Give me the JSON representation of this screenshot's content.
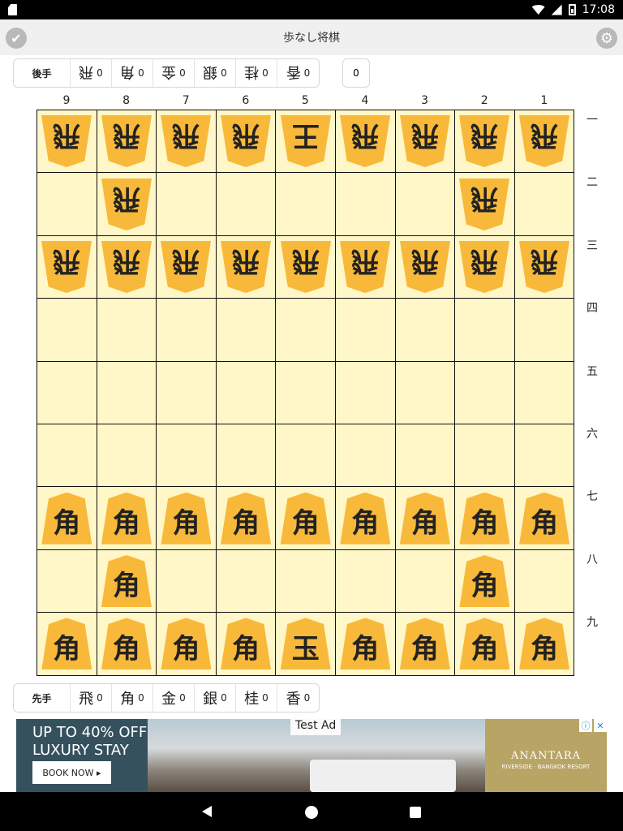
{
  "status_bar": {
    "time": "17:08"
  },
  "app": {
    "title": "歩なし将棋"
  },
  "gote_hand": {
    "label": "後手",
    "pieces": [
      {
        "kanji": "飛",
        "count": "0"
      },
      {
        "kanji": "角",
        "count": "0"
      },
      {
        "kanji": "金",
        "count": "0"
      },
      {
        "kanji": "銀",
        "count": "0"
      },
      {
        "kanji": "桂",
        "count": "0"
      },
      {
        "kanji": "香",
        "count": "0"
      }
    ],
    "extra_count": "0"
  },
  "sente_hand": {
    "label": "先手",
    "pieces": [
      {
        "kanji": "飛",
        "count": "0"
      },
      {
        "kanji": "角",
        "count": "0"
      },
      {
        "kanji": "金",
        "count": "0"
      },
      {
        "kanji": "銀",
        "count": "0"
      },
      {
        "kanji": "桂",
        "count": "0"
      },
      {
        "kanji": "香",
        "count": "0"
      }
    ]
  },
  "board": {
    "columns": [
      "9",
      "8",
      "7",
      "6",
      "5",
      "4",
      "3",
      "2",
      "1"
    ],
    "rows": [
      "一",
      "二",
      "三",
      "四",
      "五",
      "六",
      "七",
      "八",
      "九"
    ],
    "grid": [
      [
        {
          "k": "飛",
          "o": "gote"
        },
        {
          "k": "飛",
          "o": "gote"
        },
        {
          "k": "飛",
          "o": "gote"
        },
        {
          "k": "飛",
          "o": "gote"
        },
        {
          "k": "王",
          "o": "gote"
        },
        {
          "k": "飛",
          "o": "gote"
        },
        {
          "k": "飛",
          "o": "gote"
        },
        {
          "k": "飛",
          "o": "gote"
        },
        {
          "k": "飛",
          "o": "gote"
        }
      ],
      [
        null,
        {
          "k": "飛",
          "o": "gote"
        },
        null,
        null,
        null,
        null,
        null,
        {
          "k": "飛",
          "o": "gote"
        },
        null
      ],
      [
        {
          "k": "飛",
          "o": "gote"
        },
        {
          "k": "飛",
          "o": "gote"
        },
        {
          "k": "飛",
          "o": "gote"
        },
        {
          "k": "飛",
          "o": "gote"
        },
        {
          "k": "飛",
          "o": "gote"
        },
        {
          "k": "飛",
          "o": "gote"
        },
        {
          "k": "飛",
          "o": "gote"
        },
        {
          "k": "飛",
          "o": "gote"
        },
        {
          "k": "飛",
          "o": "gote"
        }
      ],
      [
        null,
        null,
        null,
        null,
        null,
        null,
        null,
        null,
        null
      ],
      [
        null,
        null,
        null,
        null,
        null,
        null,
        null,
        null,
        null
      ],
      [
        null,
        null,
        null,
        null,
        null,
        null,
        null,
        null,
        null
      ],
      [
        {
          "k": "角",
          "o": "sente"
        },
        {
          "k": "角",
          "o": "sente"
        },
        {
          "k": "角",
          "o": "sente"
        },
        {
          "k": "角",
          "o": "sente"
        },
        {
          "k": "角",
          "o": "sente"
        },
        {
          "k": "角",
          "o": "sente"
        },
        {
          "k": "角",
          "o": "sente"
        },
        {
          "k": "角",
          "o": "sente"
        },
        {
          "k": "角",
          "o": "sente"
        }
      ],
      [
        null,
        {
          "k": "角",
          "o": "sente"
        },
        null,
        null,
        null,
        null,
        null,
        {
          "k": "角",
          "o": "sente"
        },
        null
      ],
      [
        {
          "k": "角",
          "o": "sente"
        },
        {
          "k": "角",
          "o": "sente"
        },
        {
          "k": "角",
          "o": "sente"
        },
        {
          "k": "角",
          "o": "sente"
        },
        {
          "k": "玉",
          "o": "sente"
        },
        {
          "k": "角",
          "o": "sente"
        },
        {
          "k": "角",
          "o": "sente"
        },
        {
          "k": "角",
          "o": "sente"
        },
        {
          "k": "角",
          "o": "sente"
        }
      ]
    ]
  },
  "ad": {
    "headline": "UP TO 40% OFF LUXURY STAY",
    "cta": "BOOK NOW ▸",
    "tag": "Test Ad",
    "brand": "ANANTARA",
    "brand_sub": "RIVERSIDE · BANGKOK RESORT"
  },
  "colors": {
    "board": "#fff7c7",
    "piece": "#f8b93a",
    "app_bar": "#f0f0f0"
  }
}
